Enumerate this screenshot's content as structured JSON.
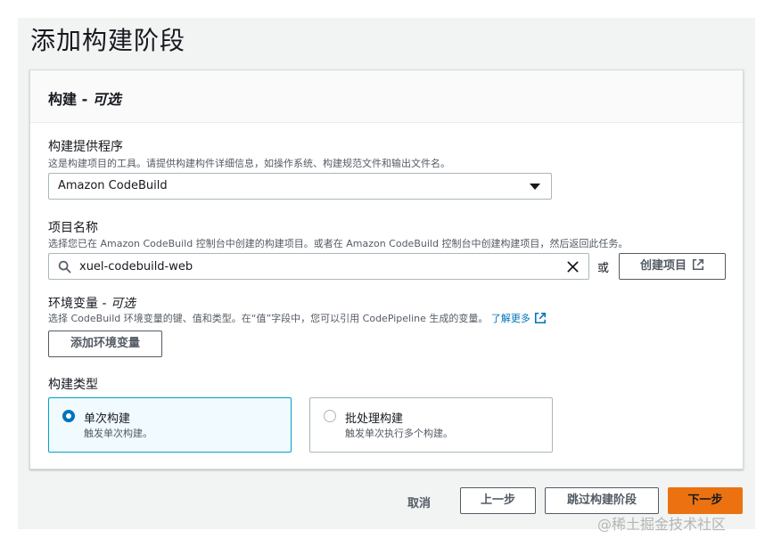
{
  "page": {
    "title": "添加构建阶段"
  },
  "panel": {
    "title": "构建 - ",
    "title_optional": "可选"
  },
  "provider": {
    "label": "构建提供程序",
    "description": "这是构建项目的工具。请提供构建构件详细信息，如操作系统、构建规范文件和输出文件名。",
    "selected": "Amazon CodeBuild"
  },
  "project": {
    "label": "项目名称",
    "description": "选择您已在 Amazon CodeBuild 控制台中创建的构建项目。或者在 Amazon CodeBuild 控制台中创建构建项目，然后返回此任务。",
    "value": "xuel-codebuild-web",
    "or": "或",
    "create_button": "创建项目"
  },
  "env": {
    "label": "环境变量 - ",
    "label_optional": "可选",
    "description": "选择 CodeBuild 环境变量的键、值和类型。在“值”字段中，您可以引用 CodePipeline 生成的变量。",
    "learn_more": "了解更多",
    "add_button": "添加环境变量"
  },
  "build_type": {
    "label": "构建类型",
    "options": [
      {
        "title": "单次构建",
        "desc": "触发单次构建。",
        "selected": true
      },
      {
        "title": "批处理构建",
        "desc": "触发单次执行多个构建。",
        "selected": false
      }
    ]
  },
  "footer": {
    "cancel": "取消",
    "previous": "上一步",
    "skip": "跳过构建阶段",
    "next": "下一步"
  },
  "watermark": "@稀土掘金技术社区",
  "colors": {
    "primary": "#ec7211",
    "link": "#0073bb",
    "selected_border": "#00a1c9",
    "selected_bg": "#f1faff"
  },
  "icons": [
    "search-icon",
    "clear-icon",
    "external-link-icon",
    "caret-down-icon"
  ]
}
